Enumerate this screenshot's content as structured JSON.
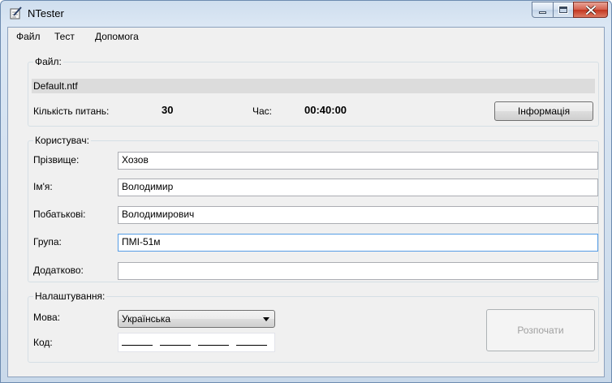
{
  "window": {
    "title": "NTester"
  },
  "menu": {
    "items": [
      "Файл",
      "Тест",
      "Допомога"
    ]
  },
  "file_group": {
    "title": "Файл:",
    "filename": "Default.ntf",
    "questions_label": "Кількість питань:",
    "questions_value": "30",
    "time_label": "Час:",
    "time_value": "00:40:00",
    "info_button": "Інформація"
  },
  "user_group": {
    "title": "Користувач:",
    "fields": [
      {
        "label": "Прізвище:",
        "value": "Хозов"
      },
      {
        "label": "Ім'я:",
        "value": "Володимир"
      },
      {
        "label": "Побатькові:",
        "value": "Володимирович"
      },
      {
        "label": "Група:",
        "value": "ПМІ-51м"
      },
      {
        "label": "Додатково:",
        "value": ""
      }
    ]
  },
  "settings_group": {
    "title": "Налаштування:",
    "language_label": "Мова:",
    "language_value": "Українська",
    "code_label": "Код:",
    "start_button": "Розпочати"
  },
  "icons": {
    "app": "notepad-pencil-icon",
    "minimize": "minimize-icon",
    "maximize": "maximize-icon",
    "close": "close-icon"
  }
}
